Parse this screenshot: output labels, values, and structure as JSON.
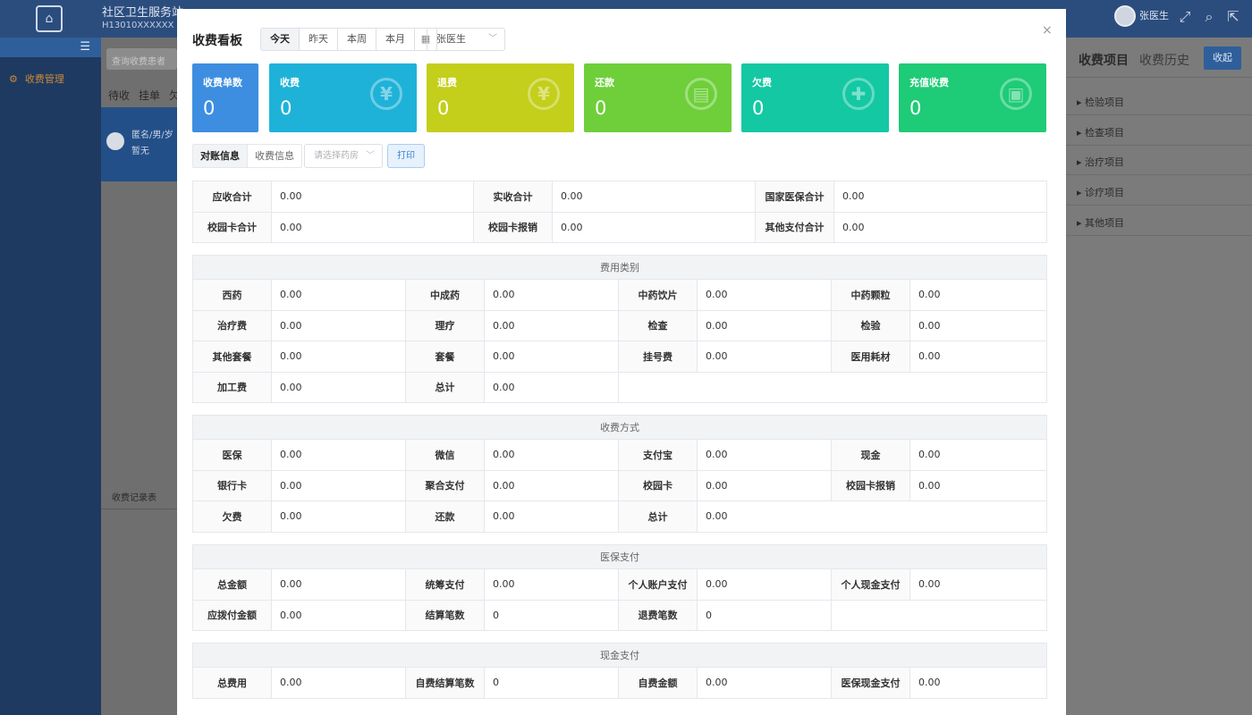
{
  "app": {
    "title": "社区卫生服务站",
    "code": "H13010XXXXXX",
    "user_name": "张医生"
  },
  "sidebar": {
    "menu_item": "收费管理"
  },
  "left_panel": {
    "search_placeholder": "查询收费患者",
    "tabs": [
      "待收",
      "挂单",
      "欠"
    ],
    "patient_name": "匿名/男/岁",
    "patient_note": "暂无",
    "footer_label": "收费记录表"
  },
  "right_panel": {
    "tab_items": "收费项目",
    "tab_history": "收费历史",
    "collapse_label": "收起",
    "items": [
      "检验项目",
      "检查项目",
      "治疗项目",
      "诊疗项目",
      "其他项目"
    ]
  },
  "modal": {
    "title": "收费看板",
    "close_icon": "×",
    "date_tabs": [
      "今天",
      "昨天",
      "本周",
      "本月"
    ],
    "date_active": "今天",
    "doctor_value": "张医生",
    "stats": [
      {
        "label": "收费单数",
        "value": "0",
        "color": "#3d8ee0",
        "icon": ""
      },
      {
        "label": "收费",
        "value": "0",
        "color": "#1fb2d8",
        "icon": "¥"
      },
      {
        "label": "退费",
        "value": "0",
        "color": "#c3cf1b",
        "icon": "¥"
      },
      {
        "label": "还款",
        "value": "0",
        "color": "#6ecf3a",
        "icon": "▤"
      },
      {
        "label": "欠费",
        "value": "0",
        "color": "#14c8a4",
        "icon": "✚"
      },
      {
        "label": "充值收费",
        "value": "0",
        "color": "#1ecb76",
        "icon": "▣"
      }
    ],
    "sub_tabs": [
      "对账信息",
      "收费信息"
    ],
    "pharmacy_placeholder": "请选择药房",
    "print_label": "打印",
    "summary": [
      [
        {
          "label": "应收合计",
          "value": "0.00"
        },
        {
          "label": "实收合计",
          "value": "0.00"
        },
        {
          "label": "国家医保合计",
          "value": "0.00"
        }
      ],
      [
        {
          "label": "校园卡合计",
          "value": "0.00"
        },
        {
          "label": "校园卡报销",
          "value": "0.00"
        },
        {
          "label": "其他支付合计",
          "value": "0.00"
        }
      ]
    ],
    "sections": [
      {
        "title": "费用类别",
        "rows": [
          [
            {
              "label": "西药",
              "value": "0.00"
            },
            {
              "label": "中成药",
              "value": "0.00"
            },
            {
              "label": "中药饮片",
              "value": "0.00"
            },
            {
              "label": "中药颗粒",
              "value": "0.00"
            }
          ],
          [
            {
              "label": "治疗费",
              "value": "0.00"
            },
            {
              "label": "理疗",
              "value": "0.00"
            },
            {
              "label": "检查",
              "value": "0.00"
            },
            {
              "label": "检验",
              "value": "0.00"
            }
          ],
          [
            {
              "label": "其他套餐",
              "value": "0.00"
            },
            {
              "label": "套餐",
              "value": "0.00"
            },
            {
              "label": "挂号费",
              "value": "0.00"
            },
            {
              "label": "医用耗材",
              "value": "0.00"
            }
          ],
          [
            {
              "label": "加工费",
              "value": "0.00"
            },
            {
              "label": "总计",
              "value": "0.00"
            }
          ]
        ]
      },
      {
        "title": "收费方式",
        "rows": [
          [
            {
              "label": "医保",
              "value": "0.00"
            },
            {
              "label": "微信",
              "value": "0.00"
            },
            {
              "label": "支付宝",
              "value": "0.00"
            },
            {
              "label": "现金",
              "value": "0.00"
            }
          ],
          [
            {
              "label": "银行卡",
              "value": "0.00"
            },
            {
              "label": "聚合支付",
              "value": "0.00"
            },
            {
              "label": "校园卡",
              "value": "0.00"
            },
            {
              "label": "校园卡报销",
              "value": "0.00"
            }
          ],
          [
            {
              "label": "欠费",
              "value": "0.00"
            },
            {
              "label": "还款",
              "value": "0.00"
            },
            {
              "label": "总计",
              "value": "0.00",
              "wide": true
            }
          ]
        ]
      },
      {
        "title": "医保支付",
        "rows": [
          [
            {
              "label": "总金额",
              "value": "0.00"
            },
            {
              "label": "统筹支付",
              "value": "0.00"
            },
            {
              "label": "个人账户支付",
              "value": "0.00"
            },
            {
              "label": "个人现金支付",
              "value": "0.00"
            }
          ],
          [
            {
              "label": "应拨付金额",
              "value": "0.00"
            },
            {
              "label": "结算笔数",
              "value": "0"
            },
            {
              "label": "退费笔数",
              "value": "0"
            }
          ]
        ]
      },
      {
        "title": "现金支付",
        "rows": [
          [
            {
              "label": "总费用",
              "value": "0.00"
            },
            {
              "label": "自费结算笔数",
              "value": "0"
            },
            {
              "label": "自费金额",
              "value": "0.00"
            },
            {
              "label": "医保现金支付",
              "value": "0.00"
            }
          ]
        ]
      }
    ]
  }
}
